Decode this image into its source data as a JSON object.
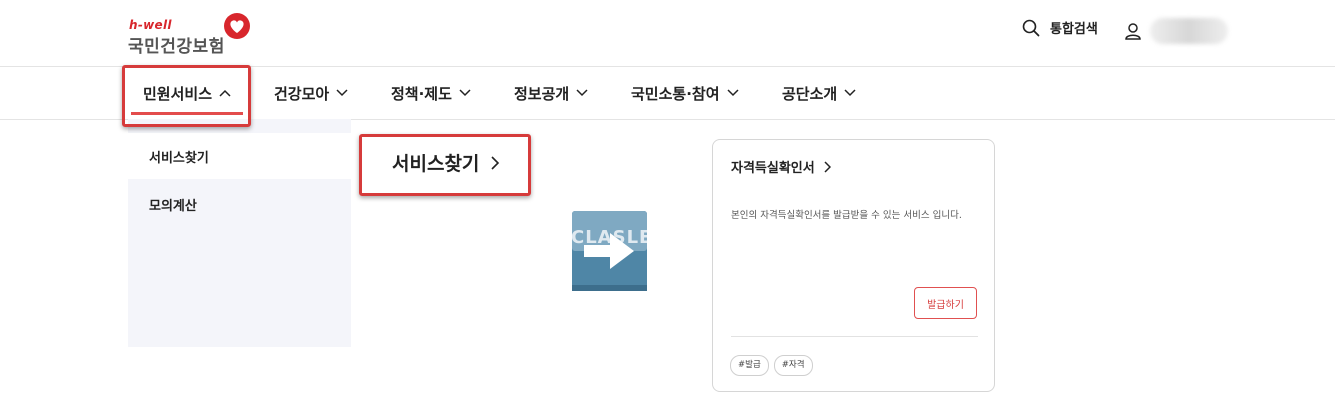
{
  "header": {
    "logo_top": "h-well",
    "logo_main": "국민건강보험",
    "search_label": "통합검색"
  },
  "nav": {
    "items": [
      {
        "label": "민원서비스",
        "icon": "chevron-up-icon",
        "active": true
      },
      {
        "label": "건강모아",
        "icon": "chevron-down-icon"
      },
      {
        "label": "정책·제도",
        "icon": "chevron-down-icon"
      },
      {
        "label": "정보공개",
        "icon": "chevron-down-icon"
      },
      {
        "label": "국민소통·참여",
        "icon": "chevron-down-icon"
      },
      {
        "label": "공단소개",
        "icon": "chevron-down-icon"
      }
    ]
  },
  "sidebar": {
    "items": [
      {
        "label": "서비스찾기",
        "active": true
      },
      {
        "label": "모의계산"
      }
    ]
  },
  "submenu": {
    "title": "서비스찾기",
    "icon": "chevron-right-icon"
  },
  "overlay": {
    "label": "CLASLE",
    "icon": "right-arrow-icon"
  },
  "card": {
    "title": "자격득실확인서",
    "description": "본인의 자격득실확인서를 발급받을 수 있는 서비스 입니다.",
    "button": "발급하기",
    "tags": [
      "#발급",
      "#자격"
    ]
  },
  "colors": {
    "accent": "#d63b3b",
    "sidebar_bg": "#f4f5fa",
    "arrow_bg": "#4f86a6"
  }
}
